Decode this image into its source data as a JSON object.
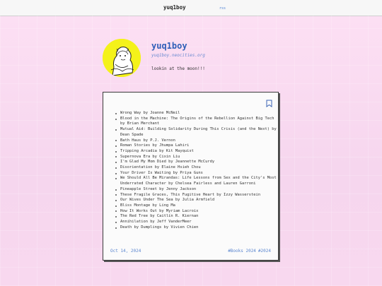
{
  "nav": {
    "site_name": "yuq1boy",
    "rss_label": "rss"
  },
  "profile": {
    "name": "yuq1boy",
    "site": "yuq1boy.neocities.org",
    "bio": "lookin at the moon!!!"
  },
  "post": {
    "books": [
      "Wrong Way by Joanne McNeil",
      "Blood in the Machine: The Origins of the Rebellion Against Big Tech by Brian Merchant",
      "Mutual Aid: Building Solidarity During This Crisis (and the Next) by Dean Spade",
      "Bath Haus by P.J. Vernon",
      "Roman Stories by Jhumpa Lahiri",
      "Tripping Arcadia by Kit Mayquist",
      "Supernova Era by Cixin Liu",
      "I'm Glad My Mom Died by Jeannette McCurdy",
      "Disorientation by Elaine Hsieh Chou",
      "Your Driver Is Waiting by Priya Guns",
      "We Should All Be Mirandas: Life Lessons from Sex and the City's Most Underrated Character by Chelsea Fairless and Lauren Garroni",
      "Pineapple Street by Jenny Jackson",
      "These Fragile Graces, This Fugitive Heart by Izzy Wasserstein",
      "Our Wives Under The Sea by Julia Armfield",
      "Bliss Montage by Ling Ma",
      "How It Works Out by Myriam Lacroix",
      "The Red Tree by Caitlín R. Kiernan",
      "Annihilation by Jeff VanderMeer",
      "Death by Dumplings by Vivien Chien"
    ],
    "date": "Oct 14, 2024",
    "tags": [
      "#Books 2024",
      "#2024"
    ]
  },
  "colors": {
    "accent": "#2f5fb8",
    "link": "#5b86cf",
    "avatar_bg": "#f4f21a"
  },
  "icons": {
    "bookmark": "bookmark-icon"
  }
}
